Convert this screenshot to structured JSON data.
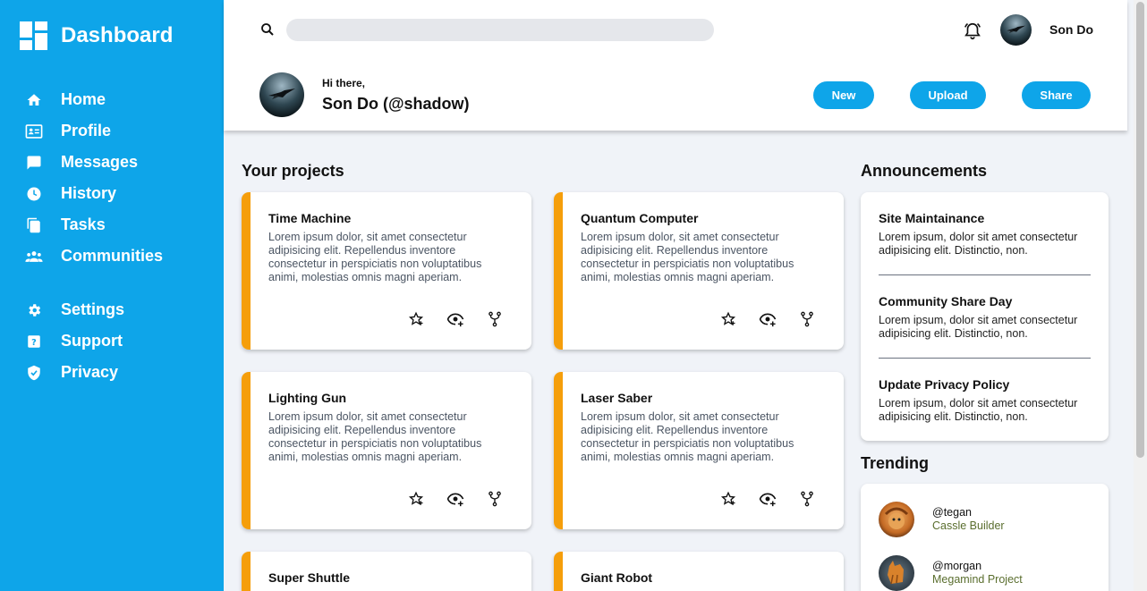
{
  "sidebar": {
    "brand": "Dashboard",
    "items": [
      {
        "label": "Home",
        "icon": "home-icon"
      },
      {
        "label": "Profile",
        "icon": "id-card-icon"
      },
      {
        "label": "Messages",
        "icon": "message-icon"
      },
      {
        "label": "History",
        "icon": "clock-icon"
      },
      {
        "label": "Tasks",
        "icon": "document-icon"
      },
      {
        "label": "Communities",
        "icon": "group-icon"
      },
      {
        "label": "Settings",
        "icon": "gear-icon"
      },
      {
        "label": "Support",
        "icon": "help-icon"
      },
      {
        "label": "Privacy",
        "icon": "shield-icon"
      }
    ]
  },
  "header": {
    "search_placeholder": "",
    "user_name": "Son Do",
    "greeting": "Hi there,",
    "full_name": "Son Do (@shadow)",
    "buttons": {
      "new": "New",
      "upload": "Upload",
      "share": "Share"
    }
  },
  "projects": {
    "title": "Your projects",
    "items": [
      {
        "title": "Time Machine",
        "desc": "Lorem ipsum dolor, sit amet consectetur adipisicing elit. Repellendus inventore consectetur in perspiciatis non voluptatibus animi, molestias omnis magni aperiam."
      },
      {
        "title": "Quantum Computer",
        "desc": "Lorem ipsum dolor, sit amet consectetur adipisicing elit. Repellendus inventore consectetur in perspiciatis non voluptatibus animi, molestias omnis magni aperiam."
      },
      {
        "title": "Lighting Gun",
        "desc": "Lorem ipsum dolor, sit amet consectetur adipisicing elit. Repellendus inventore consectetur in perspiciatis non voluptatibus animi, molestias omnis magni aperiam."
      },
      {
        "title": "Laser Saber",
        "desc": "Lorem ipsum dolor, sit amet consectetur adipisicing elit. Repellendus inventore consectetur in perspiciatis non voluptatibus animi, molestias omnis magni aperiam."
      },
      {
        "title": "Super Shuttle",
        "desc": ""
      },
      {
        "title": "Giant Robot",
        "desc": ""
      }
    ]
  },
  "announcements": {
    "title": "Announcements",
    "items": [
      {
        "title": "Site Maintainance",
        "desc": "Lorem ipsum, dolor sit amet consectetur adipisicing elit. Distinctio, non."
      },
      {
        "title": "Community Share Day",
        "desc": "Lorem ipsum, dolor sit amet consectetur adipisicing elit. Distinctio, non."
      },
      {
        "title": "Update Privacy Policy",
        "desc": "Lorem ipsum, dolor sit amet consectetur adipisicing elit. Distinctio, non."
      }
    ]
  },
  "trending": {
    "title": "Trending",
    "items": [
      {
        "handle": "@tegan",
        "project": "Cassle Builder"
      },
      {
        "handle": "@morgan",
        "project": "Megamind Project"
      }
    ]
  },
  "colors": {
    "sidebar": "#0ea5e9",
    "accent": "#0ea5e9",
    "card_stripe": "#f59e0b",
    "background": "#f0f3f8"
  }
}
